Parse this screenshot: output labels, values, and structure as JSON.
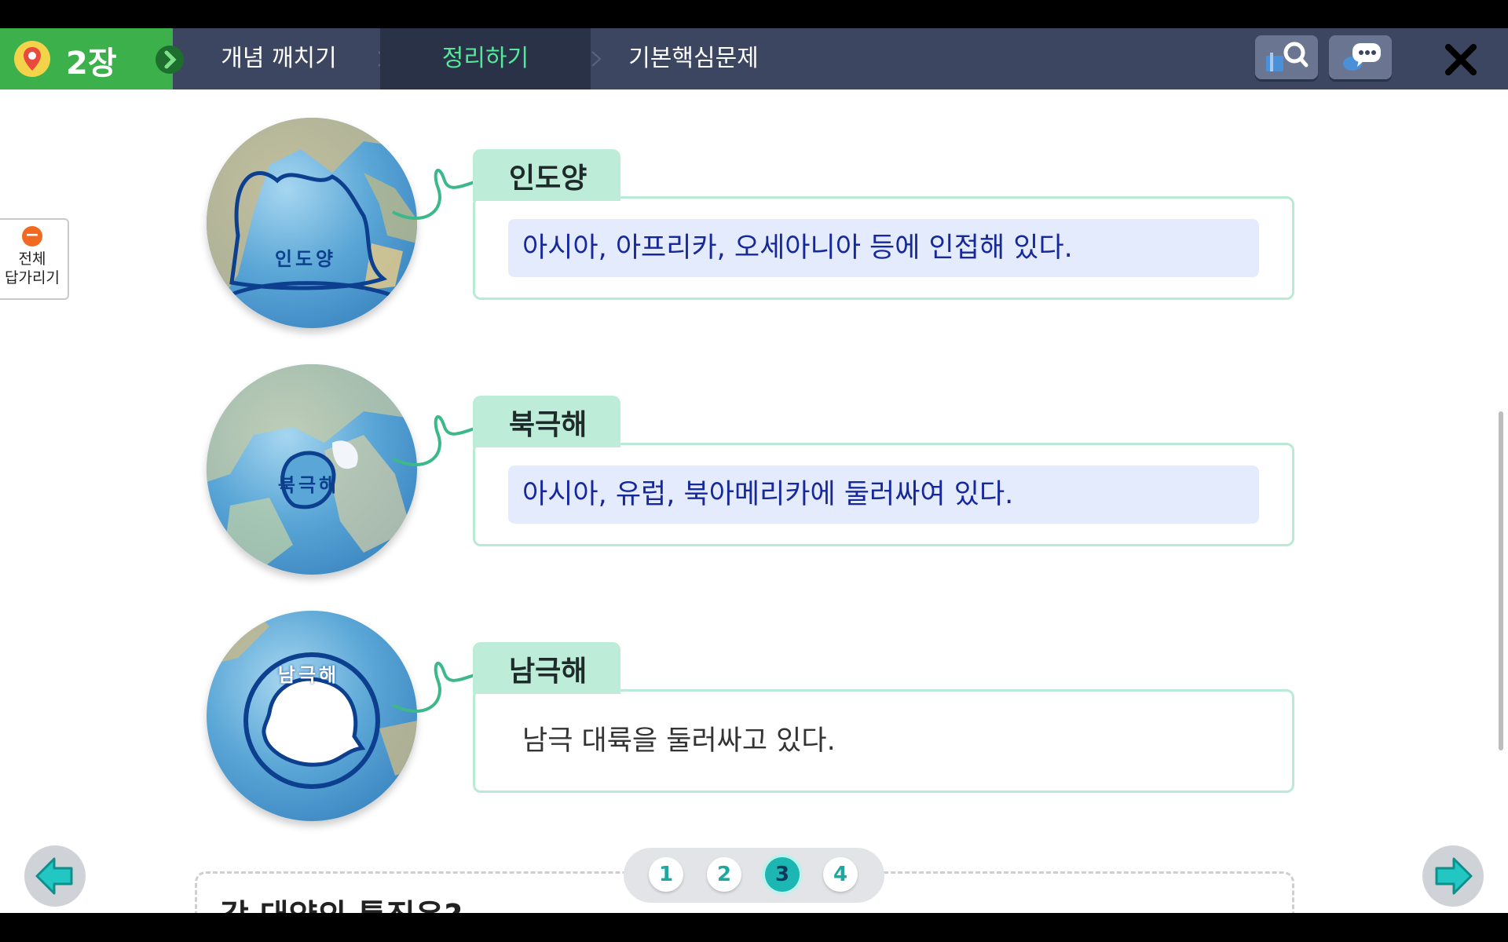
{
  "header": {
    "chapter": "2장",
    "tabs": [
      {
        "label": "개념 깨치기",
        "active": false
      },
      {
        "label": "정리하기",
        "active": true
      },
      {
        "label": "기본핵심문제",
        "active": false
      }
    ],
    "tools": [
      "search-book-icon",
      "chat-icon"
    ],
    "colors": {
      "bar": "#3d4660",
      "chapter": "#3cb04a",
      "active_tab_text": "#55e79a"
    }
  },
  "answer_toggle": {
    "line1": "전체",
    "line2": "답가리기"
  },
  "oceans": [
    {
      "globe_label": "인도양",
      "title": "인도양",
      "desc": "아시아, 아프리카, 오세아니아 등에 인접해 있다.",
      "highlighted": true
    },
    {
      "globe_label": "북극해",
      "title": "북극해",
      "desc": "아시아, 유럽, 북아메리카에 둘러싸여 있다.",
      "highlighted": true
    },
    {
      "globe_label": "남극해",
      "title": "남극해",
      "desc": "남극 대륙을 둘러싸고 있다.",
      "highlighted": false
    }
  ],
  "next_section": {
    "text": "각 대양의 특징은?"
  },
  "pager": {
    "pages": [
      "1",
      "2",
      "3",
      "4"
    ],
    "current": "3"
  }
}
